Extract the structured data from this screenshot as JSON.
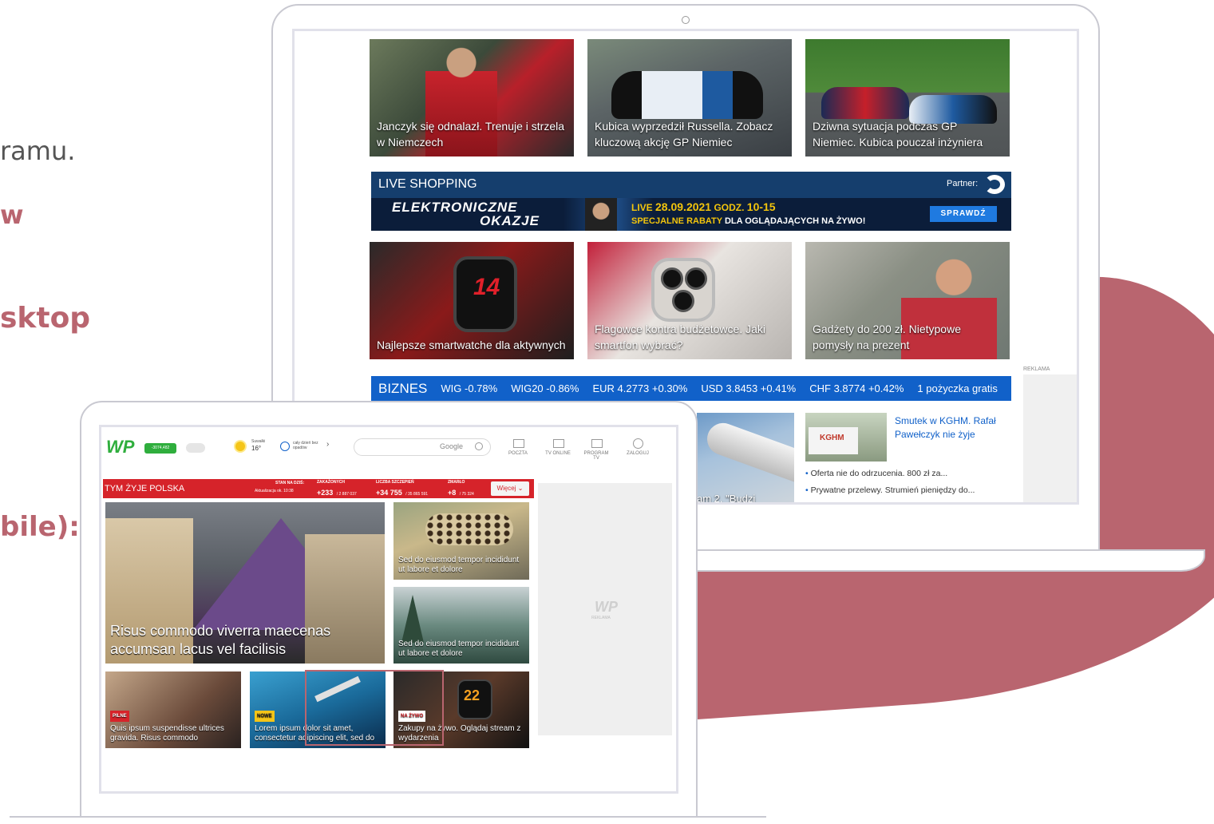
{
  "side_text": {
    "line1": "ramu.",
    "line2": "w",
    "line3": "sktop",
    "line4": "bile):"
  },
  "desktop": {
    "cards_top": [
      {
        "caption": "Janczyk się odnalazł. Trenuje i strzela w Niemczech"
      },
      {
        "caption": "Kubica wyprzedził Russella. Zobacz kluczową akcję GP Niemiec"
      },
      {
        "caption": "Dziwna sytuacja podczas GP Niemiec. Kubica pouczał inżyniera"
      }
    ],
    "live_shopping": {
      "label": "LIVE SHOPPING",
      "partner": "Partner:",
      "title_line1": "ELEKTRONICZNE",
      "title_line2": "OKAZJE",
      "live_prefix": "LIVE",
      "date": "28.09.2021",
      "godz": "GODZ.",
      "hours": "10-15",
      "promo_highlight": "SPECJALNE RABATY",
      "promo_rest": "DLA OGLĄDAJĄCYCH NA ŻYWO!",
      "button": "SPRAWDŹ"
    },
    "cards_mid": [
      {
        "caption": "Najlepsze smartwatche dla aktywnych"
      },
      {
        "caption": "Flagowce kontra budżetowce. Jaki smartfon wybrać?"
      },
      {
        "caption": "Gadżety do 200 zł. Nietypowe pomysły na prezent"
      }
    ],
    "reklama": "REKLAMA",
    "biznes": {
      "label": "BIZNES",
      "items": [
        "WIG -0.78%",
        "WIG20 -0.86%",
        "EUR 4.2773 +0.30%",
        "USD 3.8453 +0.41%",
        "CHF 3.8774 +0.42%",
        "1 pożyczka gratis"
      ]
    },
    "pipe_caption": "am 2. \"Budzi",
    "news": {
      "headline": "Smutek w KGHM. Rafał Pawełczyk nie żyje",
      "logo_text": "KGHM",
      "bullets": [
        "Oferta nie do odrzucenia. 800 zł za...",
        "Prywatne przelewy. Strumień pieniędzy do..."
      ]
    }
  },
  "mobile": {
    "header": {
      "logo": "WP",
      "badge": "-3074,482",
      "weather_city": "Suwałki",
      "weather_temp": "16°",
      "mood": "cały dzień bez opadów",
      "search_brand": "Google",
      "nav": [
        "POCZTA",
        "TV ONLINE",
        "PROGRAM TV",
        "ZALOGUJ"
      ]
    },
    "covid_bar": {
      "title": "TYM ŻYJE POLSKA",
      "stan": "STAN NA DZIŚ:",
      "updated": "Aktualizacja ok. 10:38",
      "cols": [
        {
          "head": "ZAKAŻONYCH",
          "value": "+233",
          "total": "/ 2 887 037"
        },
        {
          "head": "LICZBA SZCZEPIEŃ",
          "value": "+34 755",
          "total": "/ 35 865 591"
        },
        {
          "head": "ZMARŁO",
          "value": "+8",
          "total": "/ 75 324"
        }
      ],
      "more": "Więcej"
    },
    "hero_caption": "Risus commodo viverra maecenas accumsan lacus vel facilisis",
    "side_tiles": [
      {
        "caption": "Sed do eiusmod tempor incididunt ut labore et dolore"
      },
      {
        "caption": "Sed do eiusmod tempor incididunt ut labore et dolore"
      }
    ],
    "bottom_tiles": [
      {
        "tag": "PILNE",
        "caption": "Quis ipsum suspendisse ultrices gravida. Risus commodo"
      },
      {
        "tag": "NOWE",
        "caption": "Lorem ipsum dolor sit amet, consectetur adipiscing elit, sed do"
      },
      {
        "tag": "NA ŻYWO",
        "caption": "Zakupy na żywo. Oglądaj stream z wydarzenia"
      }
    ],
    "ad_logo": "WP",
    "ad_label": "REKLAMA"
  }
}
